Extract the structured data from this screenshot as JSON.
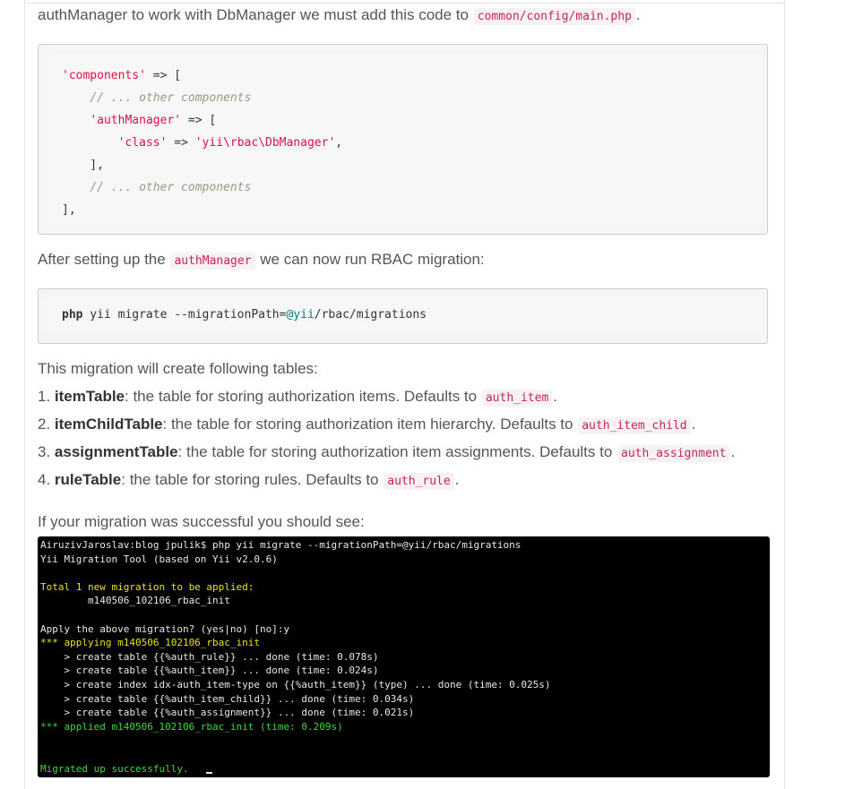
{
  "intro": {
    "text": "authManager to work with DbManager we must add this code to",
    "code": "common/config/main.php",
    "end": "."
  },
  "code_block_1": {
    "lines": [
      [
        {
          "t": "s",
          "v": "'components'"
        },
        {
          "t": "p",
          "v": " => ["
        }
      ],
      [
        {
          "t": "p",
          "v": "    "
        },
        {
          "t": "c",
          "v": "// ... other components"
        }
      ],
      [
        {
          "t": "p",
          "v": "    "
        },
        {
          "t": "s",
          "v": "'authManager'"
        },
        {
          "t": "p",
          "v": " => ["
        }
      ],
      [
        {
          "t": "p",
          "v": "        "
        },
        {
          "t": "s",
          "v": "'class'"
        },
        {
          "t": "p",
          "v": " => "
        },
        {
          "t": "s",
          "v": "'yii\\rbac\\DbManager'"
        },
        {
          "t": "p",
          "v": ","
        }
      ],
      [
        {
          "t": "p",
          "v": "    ],"
        }
      ],
      [
        {
          "t": "p",
          "v": "    "
        },
        {
          "t": "c",
          "v": "// ... other components"
        }
      ],
      [
        {
          "t": "p",
          "v": "],"
        }
      ]
    ]
  },
  "after_setup": {
    "before": "After setting up the",
    "code": "authManager",
    "after": "we can now run RBAC migration:"
  },
  "code_block_2": {
    "cmd": "php",
    "rest_1": " yii migrate --migrationPath=",
    "var": "@yii",
    "rest_2": "/rbac/migrations"
  },
  "tables_intro": "This migration will create following tables:",
  "tables": [
    {
      "num": "1.",
      "name": "itemTable",
      "desc": ": the table for storing authorization items. Defaults to",
      "code": "auth_item",
      "end": "."
    },
    {
      "num": "2.",
      "name": "itemChildTable",
      "desc": ": the table for storing authorization item hierarchy. Defaults to",
      "code": "auth_item_child",
      "end": "."
    },
    {
      "num": "3.",
      "name": "assignmentTable",
      "desc": ": the table for storing authorization item assignments. Defaults to",
      "code": "auth_assignment",
      "end": "."
    },
    {
      "num": "4.",
      "name": "ruleTable",
      "desc": ": the table for storing rules. Defaults to",
      "code": "auth_rule",
      "end": "."
    }
  ],
  "success_intro": "If your migration was successful you should see:",
  "terminal": {
    "lines": [
      {
        "c": "w",
        "v": "AiruzivJaroslav:blog jpulik$ php yii migrate --migrationPath=@yii/rbac/migrations"
      },
      {
        "c": "w",
        "v": "Yii Migration Tool (based on Yii v2.0.6)"
      },
      {
        "c": "w",
        "v": ""
      },
      {
        "c": "y",
        "v": "Total 1 new migration to be applied:"
      },
      {
        "c": "w",
        "v": "        m140506_102106_rbac_init"
      },
      {
        "c": "w",
        "v": ""
      },
      {
        "c": "w",
        "v": "Apply the above migration? (yes|no) [no]:y"
      },
      {
        "c": "y",
        "v": "*** applying m140506_102106_rbac_init"
      },
      {
        "c": "w",
        "v": "    > create table {{%auth_rule}} ... done (time: 0.078s)"
      },
      {
        "c": "w",
        "v": "    > create table {{%auth_item}} ... done (time: 0.024s)"
      },
      {
        "c": "w",
        "v": "    > create index idx-auth_item-type on {{%auth_item}} (type) ... done (time: 0.025s)"
      },
      {
        "c": "w",
        "v": "    > create table {{%auth_item_child}} ... done (time: 0.034s)"
      },
      {
        "c": "w",
        "v": "    > create table {{%auth_assignment}} ... done (time: 0.021s)"
      },
      {
        "c": "g",
        "v": "*** applied m140506_102106_rbac_init (time: 0.209s)"
      },
      {
        "c": "w",
        "v": ""
      },
      {
        "c": "w",
        "v": ""
      },
      {
        "c": "g",
        "v": "Migrated up successfully."
      }
    ]
  }
}
